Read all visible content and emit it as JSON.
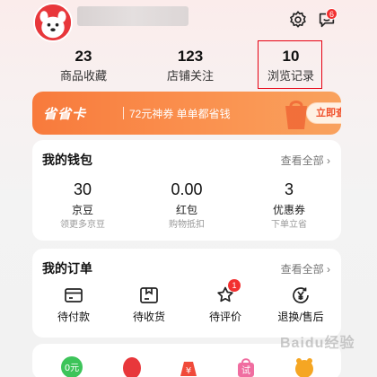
{
  "stats": [
    {
      "value": "23",
      "label": "商品收藏"
    },
    {
      "value": "123",
      "label": "店铺关注"
    },
    {
      "value": "10",
      "label": "浏览记录"
    }
  ],
  "header": {
    "message_count": "6",
    "avatar_icon": "jd-dog-avatar",
    "settings_icon": "gear-icon",
    "message_icon": "chat-bubble-icon"
  },
  "promo": {
    "title": "省省卡",
    "text": "72元神券 单单都省钱",
    "button": "立即查看"
  },
  "wallet": {
    "title": "我的钱包",
    "more": "查看全部 ›",
    "items": [
      {
        "value": "30",
        "label": "京豆",
        "sub": "领更多京豆"
      },
      {
        "value": "0.00",
        "label": "红包",
        "sub": "购物抵扣"
      },
      {
        "value": "3",
        "label": "优惠券",
        "sub": "下单立省"
      }
    ]
  },
  "orders": {
    "title": "我的订单",
    "more": "查看全部 ›",
    "items": [
      {
        "label": "待付款",
        "icon": "wallet-card-icon"
      },
      {
        "label": "待收货",
        "icon": "package-box-icon"
      },
      {
        "label": "待评价",
        "icon": "star-comment-icon",
        "badge": "1"
      },
      {
        "label": "退换/售后",
        "icon": "refund-yen-icon"
      }
    ]
  },
  "bottom_row": {
    "item1_text": "0元",
    "item4_text": "试"
  },
  "watermark": "Baidu经验",
  "colors": {
    "accent": "#e60012",
    "promo": "#f87a3c",
    "badge": "#f23030"
  }
}
